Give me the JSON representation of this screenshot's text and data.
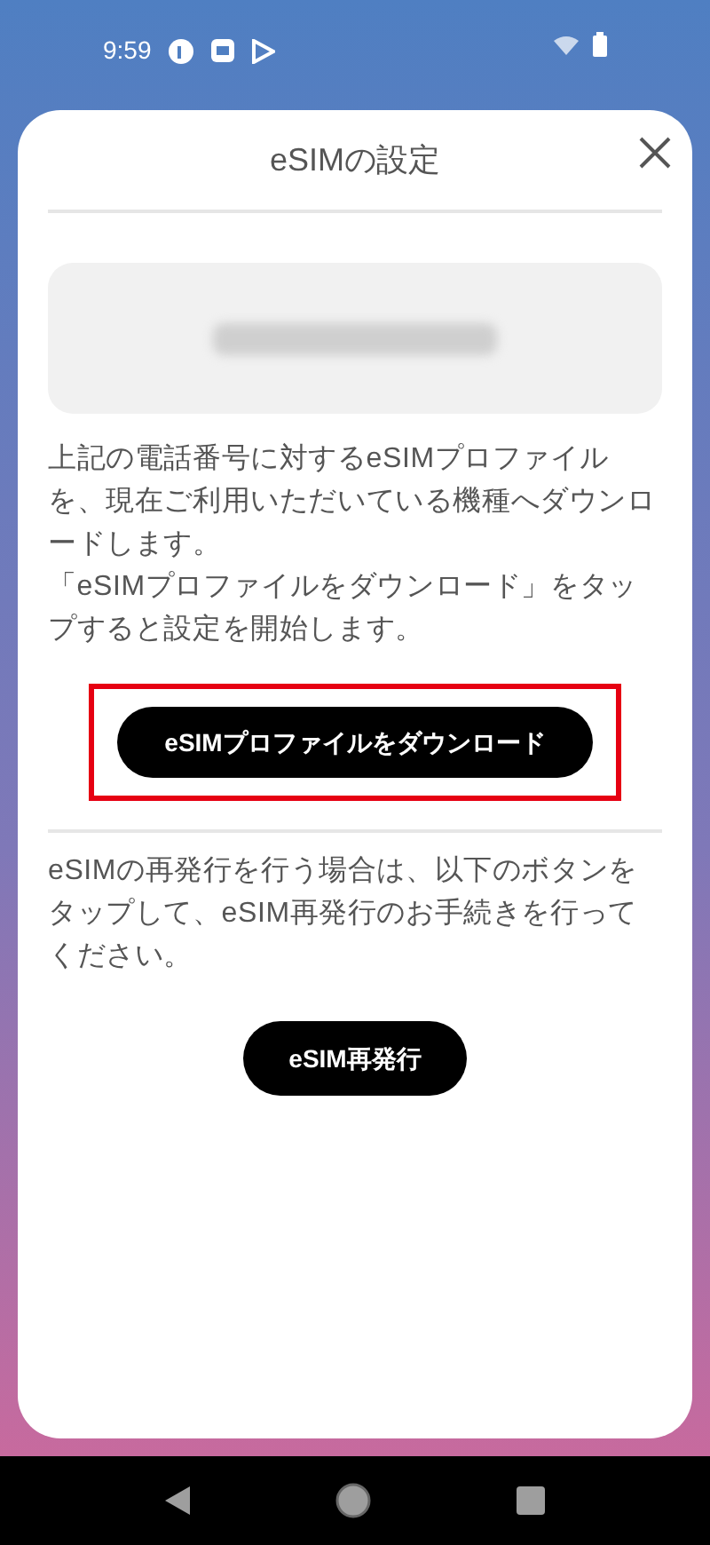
{
  "status_bar": {
    "time": "9:59"
  },
  "dialog": {
    "title": "eSIMの設定",
    "description": [
      "上記の電話番号に対するeSIMプロファイルを、現在ご利用いただいている機種へダウンロードします。",
      "「eSIMプロファイルをダウンロード」をタップすると設定を開始します。"
    ],
    "primary_button": "eSIMプロファイルをダウンロード",
    "reissue_description": "eSIMの再発行を行う場合は、以下のボタンをタップして、eSIM再発行のお手続きを行ってください。",
    "reissue_button": "eSIM再発行"
  }
}
